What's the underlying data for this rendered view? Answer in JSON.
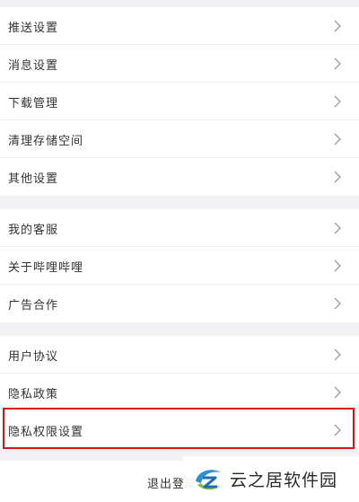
{
  "group1": [
    "推送设置",
    "消息设置",
    "下载管理",
    "清理存储空间",
    "其他设置"
  ],
  "group2": [
    "我的客服",
    "关于哔哩哔哩",
    "广告合作"
  ],
  "group3": [
    "用户协议",
    "隐私政策",
    "隐私权限设置"
  ],
  "logout_label": "退出登录",
  "watermark": {
    "text": "云之居软件园",
    "logo": "yunzhiju-logo"
  },
  "colors": {
    "highlight": "#d9111b",
    "background": "#f2f2f4",
    "row": "#ffffff"
  },
  "icons": {
    "chevron": "chevron-right-icon"
  }
}
